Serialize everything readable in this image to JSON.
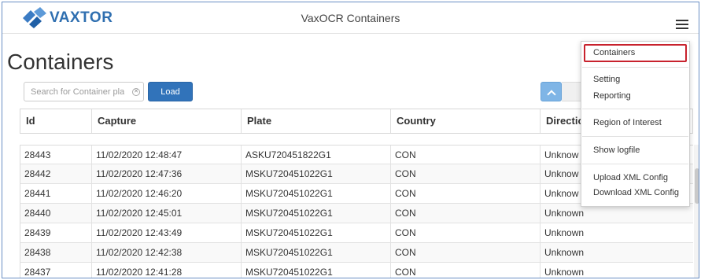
{
  "header": {
    "brand": "VAXTOR",
    "app_title": "VaxOCR Containers",
    "menu_icon": "hamburger-menu-icon",
    "brand_color": "#2f6fb0"
  },
  "page": {
    "title": "Containers"
  },
  "toolbar": {
    "search_placeholder": "Search for Container plate...",
    "load_label": "Load",
    "up_icon": "chevron-up-icon",
    "accent": "#3173ba"
  },
  "table": {
    "columns": [
      "Id",
      "Capture",
      "Plate",
      "Country",
      "Directio"
    ],
    "rows": [
      [
        "28443",
        "11/02/2020 12:48:47",
        "ASKU720451822G1",
        "CON",
        "Unknow"
      ],
      [
        "28442",
        "11/02/2020 12:47:36",
        "MSKU720451022G1",
        "CON",
        "Unknow"
      ],
      [
        "28441",
        "11/02/2020 12:46:20",
        "MSKU720451022G1",
        "CON",
        "Unknow"
      ],
      [
        "28440",
        "11/02/2020 12:45:01",
        "MSKU720451022G1",
        "CON",
        "Unknown"
      ],
      [
        "28439",
        "11/02/2020 12:43:49",
        "MSKU720451022G1",
        "CON",
        "Unknown"
      ],
      [
        "28438",
        "11/02/2020 12:42:38",
        "MSKU720451022G1",
        "CON",
        "Unknown"
      ],
      [
        "28437",
        "11/02/2020 12:41:28",
        "MSKU720451022G1",
        "CON",
        "Unknown"
      ]
    ]
  },
  "menu": {
    "items": [
      "Containers",
      "Setting",
      "Reporting",
      "Region of Interest",
      "Show logfile",
      "Upload XML Config",
      "Download XML Config"
    ],
    "highlight_color": "#c8222d"
  }
}
